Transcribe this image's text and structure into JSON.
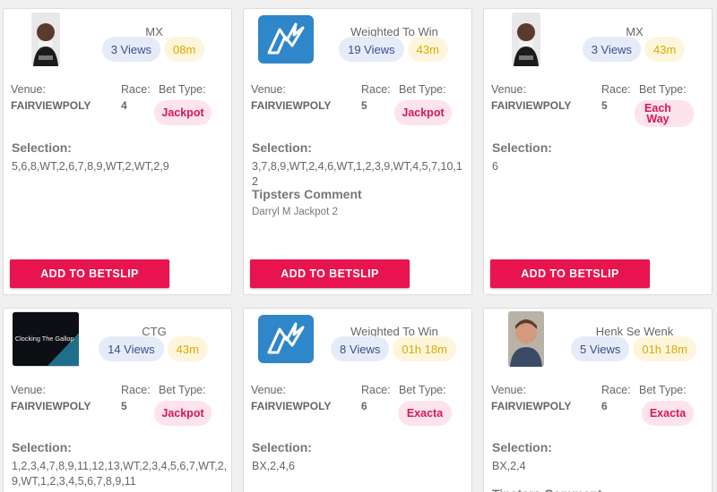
{
  "labels": {
    "venue": "Venue:",
    "race": "Race:",
    "bet_type": "Bet Type:",
    "selection": "Selection:",
    "comment": "Tipsters Comment",
    "button": "ADD TO BETSLIP"
  },
  "colors": {
    "accent": "#e8144f",
    "views_bg": "#e6ebf8",
    "time_bg": "#fdf6dc",
    "bet_bg": "#fde3ec"
  },
  "cards": [
    {
      "tipster": "MX",
      "avatar": "person-photo",
      "views": "3 Views",
      "time": "08m",
      "venue": "FAIRVIEWPOLY",
      "race": "4",
      "bet_type": "Jackpot",
      "selection": "5,6,8,WT,2,6,7,8,9,WT,2,WT,2,9",
      "comment": ""
    },
    {
      "tipster": "Weighted To Win",
      "avatar": "horse-logo-icon",
      "views": "19 Views",
      "time": "43m",
      "venue": "FAIRVIEWPOLY",
      "race": "5",
      "bet_type": "Jackpot",
      "selection": "3,7,8,9,WT,2,4,6,WT,1,2,3,9,WT,4,5,7,10,12",
      "comment": "Darryl M Jackpot 2"
    },
    {
      "tipster": "MX",
      "avatar": "person-photo",
      "views": "3 Views",
      "time": "43m",
      "venue": "FAIRVIEWPOLY",
      "race": "5",
      "bet_type": "Each Way",
      "selection": "6",
      "comment": ""
    },
    {
      "tipster": "CTG",
      "avatar": "clocking-the-gallop-logo",
      "logo_text": "Clocking The Gallop",
      "views": "14 Views",
      "time": "43m",
      "venue": "FAIRVIEWPOLY",
      "race": "5",
      "bet_type": "Jackpot",
      "selection": "1,2,3,4,7,8,9,11,12,13,WT,2,3,4,5,6,7,WT,2,9,WT,1,2,3,4,5,6,7,8,9,11",
      "comment": ""
    },
    {
      "tipster": "Weighted To Win",
      "avatar": "horse-logo-icon",
      "views": "8 Views",
      "time": "01h 18m",
      "venue": "FAIRVIEWPOLY",
      "race": "6",
      "bet_type": "Exacta",
      "selection": "BX,2,4,6",
      "comment": ""
    },
    {
      "tipster": "Henk Se Wenk",
      "avatar": "person-photo",
      "views": "5 Views",
      "time": "01h 18m",
      "venue": "FAIRVIEWPOLY",
      "race": "6",
      "bet_type": "Exacta",
      "selection": "BX,2,4",
      "comment": ""
    }
  ]
}
